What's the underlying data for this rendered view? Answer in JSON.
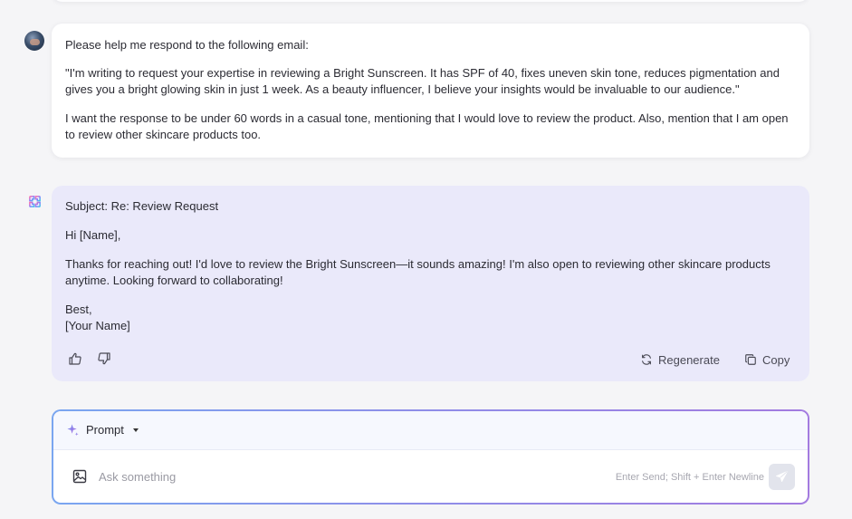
{
  "conversation": {
    "user_message": {
      "avatar_icon": "user-avatar",
      "line1": "Please help me respond to the following email:",
      "quote": "\"I'm writing to request your expertise in reviewing a Bright Sunscreen. It has SPF of 40, fixes uneven skin tone, reduces pigmentation and gives you a bright glowing skin in just 1 week. As a beauty influencer, I believe your insights would be invaluable to our audience.\"",
      "instruction": "I want the response to be under 60 words in a casual tone, mentioning that I would love to review the product. Also, mention that I am open to review other skincare products too."
    },
    "bot_message": {
      "bot_icon": "assistant-logo-icon",
      "subject": "Subject: Re: Review Request",
      "greeting": "Hi [Name],",
      "body": "Thanks for reaching out! I'd love to review the Bright Sunscreen—it sounds amazing! I'm also open to reviewing other skincare products anytime. Looking forward to collaborating!",
      "signoff": "Best,",
      "signature": "[Your Name]",
      "actions": {
        "regenerate_label": "Regenerate",
        "copy_label": "Copy"
      }
    }
  },
  "composer": {
    "mode_label": "Prompt",
    "placeholder": "Ask something",
    "hint": "Enter Send; Shift + Enter Newline"
  },
  "colors": {
    "bot_card_bg": "#eae9fa",
    "accent_gradient_start": "#7aa6f0",
    "accent_gradient_end": "#a37be0"
  }
}
